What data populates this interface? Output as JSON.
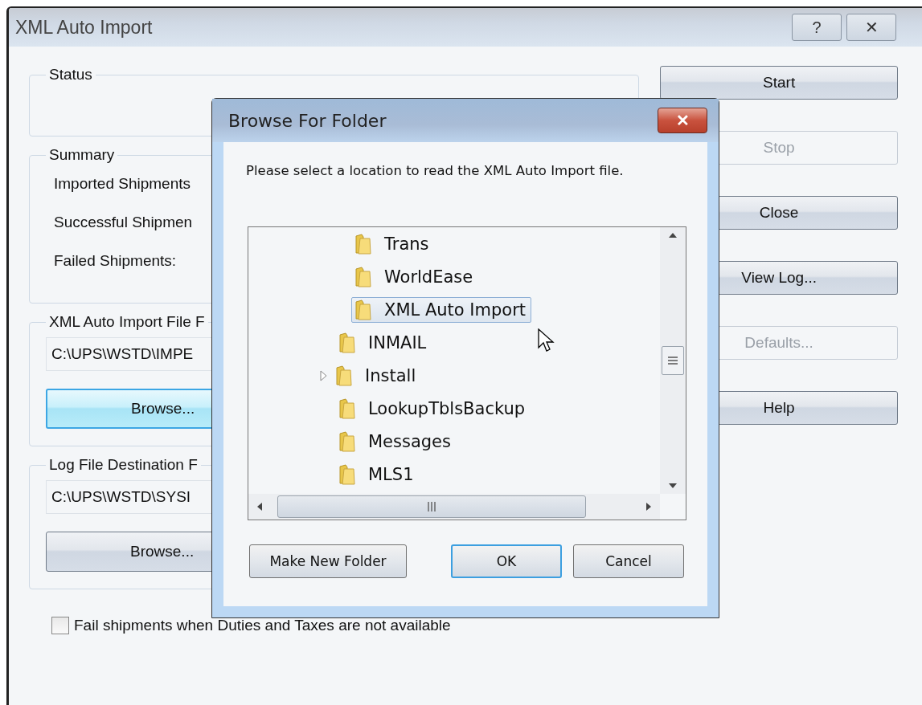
{
  "window": {
    "title": "XML Auto Import",
    "help_button": "?",
    "close_button": "✕"
  },
  "groups": [
    {
      "kind": "status",
      "title": "Status"
    },
    {
      "kind": "summary",
      "title": "Summary",
      "rows": [
        "Imported Shipments",
        "Successful Shipmen",
        "Failed Shipments:"
      ]
    },
    {
      "kind": "path",
      "title": "XML Auto Import File F",
      "value": "C:\\UPS\\WSTD\\IMPE",
      "button": {
        "label": "Browse...",
        "focused": true
      }
    },
    {
      "kind": "path",
      "title": "Log File Destination F",
      "value": "C:\\UPS\\WSTD\\SYSI",
      "button": {
        "label": "Browse...",
        "focused": false
      }
    }
  ],
  "checkbox": {
    "label": "Fail shipments when Duties and Taxes are not available",
    "checked": false
  },
  "side_buttons": [
    {
      "label": "Start",
      "disabled": false
    },
    {
      "label": "Stop",
      "disabled": true
    },
    {
      "label": "Close",
      "disabled": false
    },
    {
      "label": "View Log...",
      "disabled": false
    },
    {
      "label": "Defaults...",
      "disabled": true
    },
    {
      "label": "Help",
      "disabled": false
    }
  ],
  "dialog": {
    "title": "Browse For Folder",
    "close_button": "✕",
    "message": "Please select a location to read the XML Auto Import file.",
    "tree": [
      {
        "children": [
          {
            "label": "Trans",
            "selected": false,
            "expandable": false
          },
          {
            "label": "WorldEase",
            "selected": false,
            "expandable": false
          },
          {
            "label": "XML Auto Import",
            "selected": true,
            "expandable": false
          }
        ]
      },
      {
        "label": "INMAIL",
        "selected": false,
        "expandable": false
      },
      {
        "label": "Install",
        "selected": false,
        "expandable": true
      },
      {
        "label": "LookupTblsBackup",
        "selected": false,
        "expandable": false
      },
      {
        "label": "Messages",
        "selected": false,
        "expandable": false
      },
      {
        "label": "MLS1",
        "selected": false,
        "expandable": false
      }
    ],
    "buttons": [
      {
        "label": "Make New Folder",
        "default": false
      },
      {
        "label": "OK",
        "default": true
      },
      {
        "label": "Cancel",
        "default": false
      }
    ]
  }
}
